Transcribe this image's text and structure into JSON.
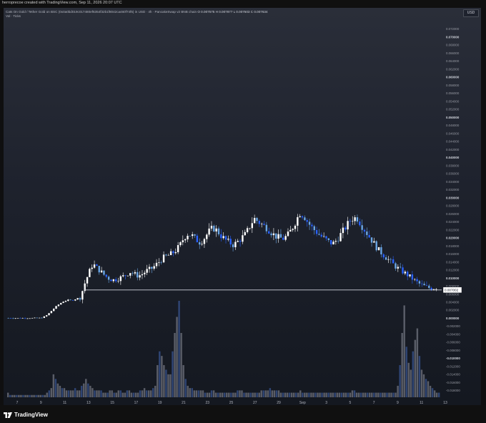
{
  "header": {
    "credit": "herroprecoe created with TradingView.com, Sep 11, 2026 20:07 UTC"
  },
  "legend": {
    "symbol": "Cats On Gold / Tether Gold on BSC (0x0a0bd019c017480ef6354f32b1f8042ca460f74f6) in USD · 4h · PancakeSwap v2 BNB chain",
    "ohlc": "O 0.007575  H 0.007877  L 0.007503  C 0.007634",
    "volume_label": "Vol · Ticks"
  },
  "currency_tag": "USD",
  "last_price_label": "0.007002",
  "brand": {
    "name": "TradingView",
    "icon": "tradingview-logo-icon"
  },
  "colors": {
    "up": "#ffffff",
    "down": "#2962ff",
    "down_light": "#6aa6e6",
    "volume_up": "#787b86",
    "volume_down": "#3b5998",
    "price_line": "#d1d4dc"
  },
  "chart_data": {
    "type": "candlestick",
    "x_ticks": [
      "7",
      "9",
      "11",
      "13",
      "15",
      "17",
      "19",
      "21",
      "23",
      "25",
      "27",
      "29",
      "Sep",
      "3",
      "5",
      "7",
      "9",
      "11",
      "13"
    ],
    "price_axis_ticks": [
      "0.072000",
      "0.070000",
      "0.068000",
      "0.066000",
      "0.064000",
      "0.062000",
      "0.060000",
      "0.058000",
      "0.056000",
      "0.054000",
      "0.052000",
      "0.050000",
      "0.048000",
      "0.046000",
      "0.044000",
      "0.042000",
      "0.040000",
      "0.038000",
      "0.036000",
      "0.034000",
      "0.032000",
      "0.030000",
      "0.028000",
      "0.026000",
      "0.024000",
      "0.022000",
      "0.020000",
      "0.018000",
      "0.016000",
      "0.014000",
      "0.012000",
      "0.010000",
      "0.008000",
      "0.006000",
      "0.004000",
      "0.002000",
      "0.000000",
      "-0.002000",
      "-0.004000",
      "-0.006000",
      "-0.008000",
      "-0.010000",
      "-0.012000",
      "-0.014000",
      "-0.016000",
      "-0.018000"
    ],
    "ylim": [
      -0.019,
      0.0735
    ],
    "last_price": 0.007002,
    "price_path": [
      [
        0,
        0.0
      ],
      [
        16,
        0.0
      ],
      [
        18,
        0.0002
      ],
      [
        20,
        0.0008
      ],
      [
        22,
        0.0018
      ],
      [
        24,
        0.0028
      ],
      [
        26,
        0.0036
      ],
      [
        28,
        0.0042
      ],
      [
        30,
        0.0045
      ],
      [
        32,
        0.0044
      ],
      [
        34,
        0.0048
      ],
      [
        36,
        0.0052
      ],
      [
        38,
        0.0085
      ],
      [
        40,
        0.0112
      ],
      [
        42,
        0.0135
      ],
      [
        44,
        0.0125
      ],
      [
        46,
        0.0115
      ],
      [
        48,
        0.0105
      ],
      [
        50,
        0.0098
      ],
      [
        52,
        0.0095
      ],
      [
        54,
        0.0098
      ],
      [
        56,
        0.0102
      ],
      [
        58,
        0.0108
      ],
      [
        60,
        0.0115
      ],
      [
        62,
        0.011
      ],
      [
        64,
        0.0105
      ],
      [
        66,
        0.011
      ],
      [
        68,
        0.0118
      ],
      [
        70,
        0.0122
      ],
      [
        72,
        0.013
      ],
      [
        74,
        0.014
      ],
      [
        76,
        0.015
      ],
      [
        78,
        0.0155
      ],
      [
        80,
        0.016
      ],
      [
        82,
        0.0168
      ],
      [
        84,
        0.018
      ],
      [
        86,
        0.02
      ],
      [
        88,
        0.021
      ],
      [
        90,
        0.0205
      ],
      [
        92,
        0.0195
      ],
      [
        94,
        0.0188
      ],
      [
        96,
        0.02
      ],
      [
        98,
        0.0215
      ],
      [
        100,
        0.0225
      ],
      [
        102,
        0.0218
      ],
      [
        104,
        0.0205
      ],
      [
        106,
        0.0195
      ],
      [
        108,
        0.0188
      ],
      [
        110,
        0.0182
      ],
      [
        112,
        0.019
      ],
      [
        114,
        0.02
      ],
      [
        116,
        0.021
      ],
      [
        118,
        0.023
      ],
      [
        120,
        0.0248
      ],
      [
        122,
        0.024
      ],
      [
        124,
        0.0232
      ],
      [
        126,
        0.0225
      ],
      [
        128,
        0.0215
      ],
      [
        130,
        0.0205
      ],
      [
        132,
        0.02
      ],
      [
        134,
        0.0198
      ],
      [
        136,
        0.0205
      ],
      [
        138,
        0.022
      ],
      [
        140,
        0.024
      ],
      [
        142,
        0.0262
      ],
      [
        144,
        0.0255
      ],
      [
        146,
        0.0238
      ],
      [
        148,
        0.0225
      ],
      [
        150,
        0.0215
      ],
      [
        152,
        0.0205
      ],
      [
        154,
        0.0198
      ],
      [
        156,
        0.019
      ],
      [
        158,
        0.0185
      ],
      [
        160,
        0.0195
      ],
      [
        162,
        0.021
      ],
      [
        164,
        0.0225
      ],
      [
        166,
        0.024
      ],
      [
        168,
        0.025
      ],
      [
        170,
        0.0248
      ],
      [
        172,
        0.023
      ],
      [
        174,
        0.0215
      ],
      [
        176,
        0.02
      ],
      [
        178,
        0.0185
      ],
      [
        180,
        0.017
      ],
      [
        182,
        0.016
      ],
      [
        184,
        0.015
      ],
      [
        186,
        0.014
      ],
      [
        188,
        0.013
      ],
      [
        190,
        0.0122
      ],
      [
        192,
        0.0115
      ],
      [
        194,
        0.0108
      ],
      [
        196,
        0.01
      ],
      [
        198,
        0.0092
      ],
      [
        200,
        0.0085
      ],
      [
        202,
        0.008
      ],
      [
        204,
        0.0076
      ],
      [
        206,
        0.0074
      ],
      [
        208,
        0.0076
      ]
    ],
    "volume": [
      2,
      1,
      1,
      1,
      1,
      1,
      1,
      1,
      1,
      1,
      1,
      1,
      1,
      1,
      1,
      1,
      1,
      1,
      2,
      3,
      4,
      10,
      8,
      6,
      5,
      4,
      4,
      3,
      3,
      3,
      3,
      4,
      3,
      3,
      5,
      6,
      8,
      6,
      5,
      4,
      3,
      3,
      3,
      3,
      2,
      2,
      2,
      3,
      3,
      2,
      2,
      3,
      3,
      2,
      2,
      3,
      3,
      2,
      2,
      2,
      2,
      3,
      3,
      4,
      3,
      3,
      3,
      4,
      5,
      14,
      20,
      18,
      14,
      12,
      10,
      10,
      20,
      28,
      35,
      42,
      28,
      14,
      8,
      5,
      4,
      4,
      3,
      3,
      3,
      3,
      3,
      2,
      2,
      2,
      3,
      3,
      2,
      2,
      2,
      2,
      2,
      2,
      2,
      2,
      2,
      2,
      3,
      3,
      3,
      2,
      2,
      2,
      2,
      2,
      2,
      2,
      2,
      3,
      3,
      3,
      3,
      4,
      3,
      3,
      3,
      3,
      2,
      2,
      2,
      2,
      2,
      2,
      2,
      2,
      2,
      3,
      2,
      2,
      2,
      2,
      2,
      2,
      2,
      2,
      2,
      2,
      2,
      2,
      2,
      2,
      2,
      2,
      2,
      2,
      2,
      2,
      2,
      2,
      2,
      3,
      3,
      2,
      2,
      2,
      2,
      2,
      2,
      2,
      2,
      2,
      2,
      2,
      2,
      2,
      2,
      2,
      2,
      2,
      2,
      2,
      5,
      14,
      28,
      40,
      22,
      15,
      12,
      20,
      25,
      30,
      18,
      12,
      10,
      8,
      7,
      5,
      4,
      3,
      2,
      2
    ],
    "volume_max": 42
  }
}
